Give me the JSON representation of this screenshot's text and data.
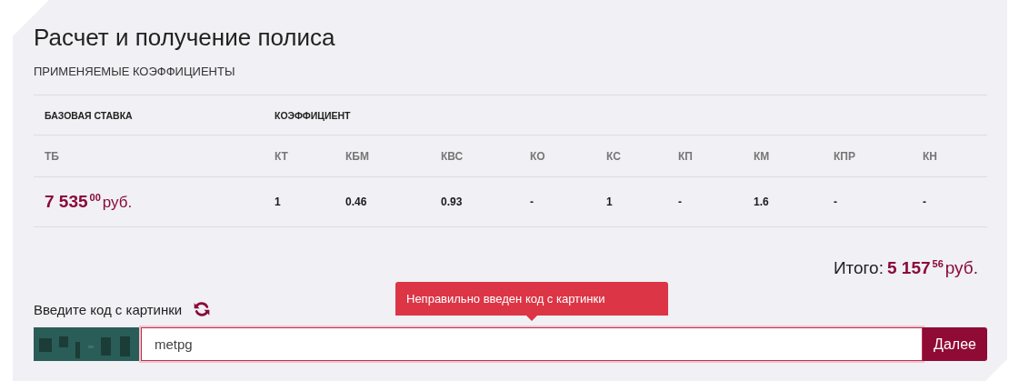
{
  "title": "Расчет и получение полиса",
  "section_label": "ПРИМЕНЯЕМЫЕ КОЭФФИЦИЕНТЫ",
  "table": {
    "groups": [
      "БАЗОВАЯ СТАВКА",
      "КОЭФФИЦИЕНТ"
    ],
    "columns": [
      "ТБ",
      "КТ",
      "КБМ",
      "КВС",
      "КО",
      "КС",
      "КП",
      "КМ",
      "КПР",
      "КН"
    ],
    "base_rate": {
      "amount": "7 535",
      "cents": "00",
      "currency": "руб."
    },
    "values": [
      "1",
      "0.46",
      "0.93",
      "-",
      "1",
      "-",
      "1.6",
      "-",
      "-"
    ]
  },
  "total": {
    "label": "Итого:",
    "amount": "5 157",
    "cents": "56",
    "currency": "руб."
  },
  "captcha": {
    "label": "Введите код с картинки",
    "value": "metpg",
    "error": "Неправильно введен код с картинки",
    "invalid": true,
    "button": "Далее"
  }
}
